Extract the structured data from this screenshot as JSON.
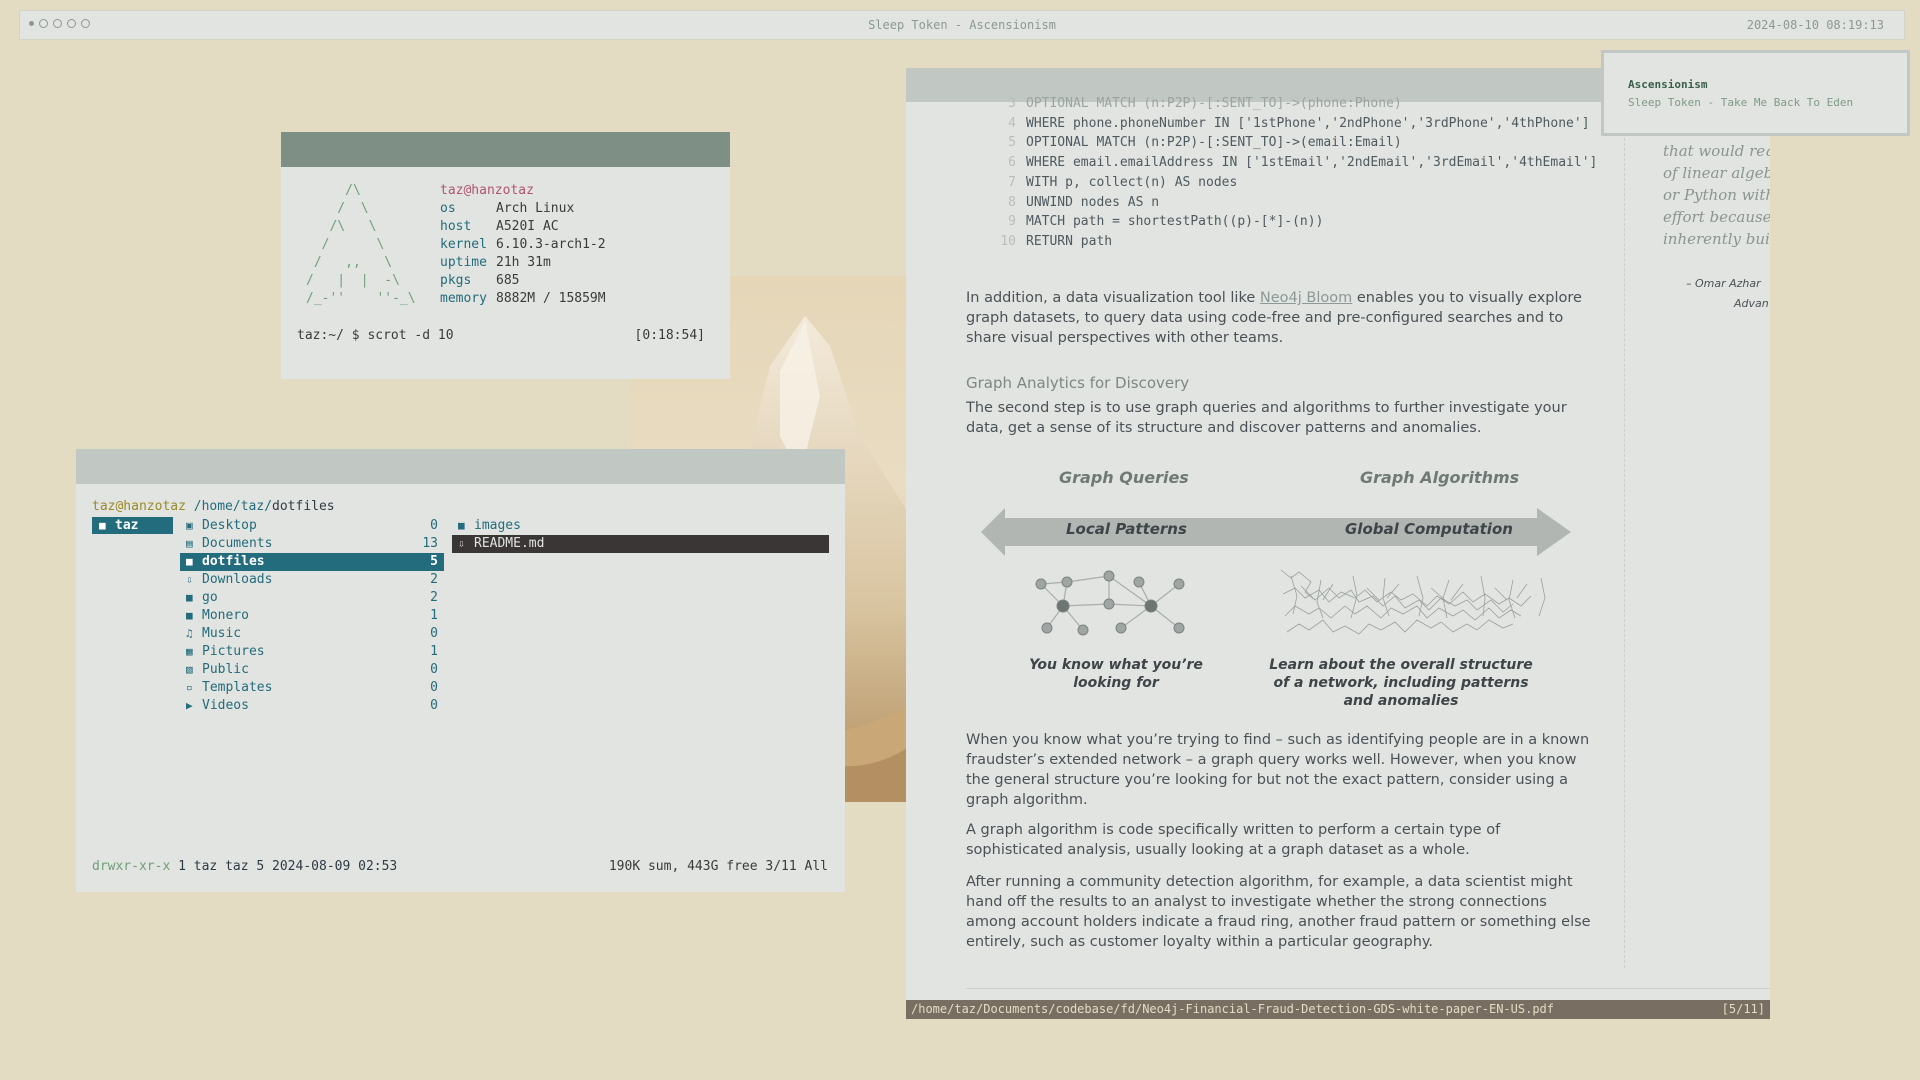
{
  "bar": {
    "title": "Sleep Token - Ascensionism",
    "clock": "2024-08-10 08:19:13"
  },
  "fetch": {
    "logo": "     /\\\n    /  \\\n   /\\   \\\n  /      \\\n /   ,,   \\\n/   |  |  -\\\n/_-''    ''-_\\",
    "user": "taz@hanzotaz",
    "rows": [
      {
        "k": "os",
        "v": "Arch Linux"
      },
      {
        "k": "host",
        "v": "A520I AC"
      },
      {
        "k": "kernel",
        "v": "6.10.3-arch1-2"
      },
      {
        "k": "uptime",
        "v": "21h 31m"
      },
      {
        "k": "pkgs",
        "v": "685"
      },
      {
        "k": "memory",
        "v": "8882M / 15859M"
      }
    ],
    "prompt": "taz:~/ $ scrot -d 10",
    "time": "[0:18:54]"
  },
  "fm": {
    "user": "taz@hanzotaz",
    "dir": " /home/taz/",
    "current": "dotfiles",
    "parent": "taz",
    "entries": [
      {
        "icon": "desktop-icon",
        "name": "Desktop",
        "count": "0"
      },
      {
        "icon": "documents-icon",
        "name": "Documents",
        "count": "13"
      },
      {
        "icon": "folder-icon",
        "name": "dotfiles",
        "count": "5"
      },
      {
        "icon": "downloads-icon",
        "name": "Downloads",
        "count": "2"
      },
      {
        "icon": "folder-icon",
        "name": "go",
        "count": "2"
      },
      {
        "icon": "folder-icon",
        "name": "Monero",
        "count": "1"
      },
      {
        "icon": "music-icon",
        "name": "Music",
        "count": "0"
      },
      {
        "icon": "pictures-icon",
        "name": "Pictures",
        "count": "1"
      },
      {
        "icon": "public-icon",
        "name": "Public",
        "count": "0"
      },
      {
        "icon": "templates-icon",
        "name": "Templates",
        "count": "0"
      },
      {
        "icon": "videos-icon",
        "name": "Videos",
        "count": "0"
      }
    ],
    "preview": [
      {
        "icon": "folder-icon",
        "name": "images"
      },
      {
        "icon": "download-file-icon",
        "name": "README.md"
      }
    ],
    "perm": "drwxr-xr-x",
    "meta": " 1 taz taz 5 2024-08-09 02:53",
    "summary": "190K sum, 443G free  3/11  All"
  },
  "pdf": {
    "code": [
      {
        "n": "3",
        "t": "OPTIONAL MATCH (n:P2P)-[:SENT_TO]->(phone:Phone)"
      },
      {
        "n": "4",
        "t": "WHERE phone.phoneNumber IN ['1stPhone','2ndPhone','3rdPhone','4thPhone']"
      },
      {
        "n": "5",
        "t": "OPTIONAL MATCH (n:P2P)-[:SENT_TO]->(email:Email)"
      },
      {
        "n": "6",
        "t": "WHERE email.emailAddress IN ['1stEmail','2ndEmail','3rdEmail','4thEmail']"
      },
      {
        "n": "7",
        "t": "WITH p, collect(n) AS nodes"
      },
      {
        "n": "8",
        "t": "UNWIND nodes AS n"
      },
      {
        "n": "9",
        "t": "MATCH path = shortestPath((p)-[*]-(n))"
      },
      {
        "n": "10",
        "t": "RETURN path"
      }
    ],
    "para1_a": "In addition, a data visualization tool like ",
    "para1_link": "Neo4j Bloom",
    "para1_b": " enables you to visually explore graph datasets, to query data using code-free and pre-configured searches and to share visual perspectives with other teams.",
    "heading": "Graph Analytics for Discovery",
    "para2": "The second step is to use graph queries and algorithms to further investigate your data, get a sense of its structure and discover patterns and anomalies.",
    "fig": {
      "left_title": "Graph Queries",
      "right_title": "Graph Algorithms",
      "left_band": "Local Patterns",
      "right_band": "Global Computation",
      "left_caption": "You know what you’re looking for",
      "right_caption": "Learn about the overall structure of a network, including patterns and anomalies"
    },
    "para3": "When you know what you’re trying to find – such as identifying people are in a known fraudster’s extended network – a graph query works well. However, when you know the general structure you’re looking for but not the exact pattern, consider using a graph algorithm.",
    "para4": "A graph algorithm is code specifically written to perform a certain type of sophisticated analysis, usually looking at a graph dataset as a whole.",
    "para5": "After running a community detection algorithm, for example, a data scientist might hand off the results to an analyst to investigate whether the strong connections among account holders indicate a fraud ring, another fraud pattern or something else entirely, such as customer loyalty within a particular geography.",
    "side_quote": [
      "that would requ",
      "of linear algebr",
      "or Python witho",
      "effort because t",
      "inherently build"
    ],
    "attrib": [
      "– Omar Azhar",
      "Advan"
    ],
    "status_path": "/home/taz/Documents/codebase/fd/Neo4j-Financial-Fraud-Detection-GDS-white-paper-EN-US.pdf",
    "status_page": "[5/11]"
  },
  "notif": {
    "title": "Ascensionism",
    "body": "Sleep Token - Take Me Back To Eden"
  },
  "colors": {
    "background": "#e4dcc2",
    "accent": "#236c7d",
    "window_header": "#7e9086"
  }
}
